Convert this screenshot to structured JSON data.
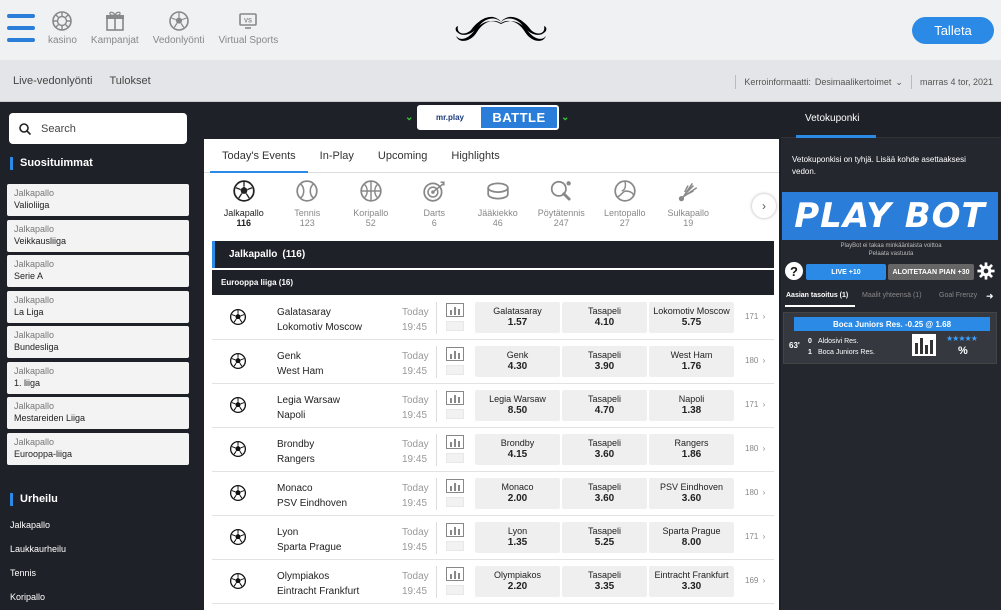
{
  "header": {
    "nav": [
      {
        "label": "kasino",
        "icon": "casino-chip-icon"
      },
      {
        "label": "Kampanjat",
        "icon": "gift-box-icon"
      },
      {
        "label": "Vedonlyönti",
        "icon": "soccer-ball-icon"
      },
      {
        "label": "Virtual Sports",
        "icon": "virtual-screen-icon"
      }
    ],
    "logo": "mustache-logo",
    "cta": "Talleta"
  },
  "subnav": {
    "links": [
      "Live-vedonlyönti",
      "Tulokset"
    ],
    "odds_label": "Kerroinformaatti:",
    "odds_value": "Desimaalikertoimet",
    "date": "marras 4 tor, 2021"
  },
  "sidebar": {
    "search_placeholder": "Search",
    "favorites_title": "Suosituimmat",
    "favorites": [
      {
        "sport": "Jalkapallo",
        "league": "Valioliiga"
      },
      {
        "sport": "Jalkapallo",
        "league": "Veikkausliiga"
      },
      {
        "sport": "Jalkapallo",
        "league": "Serie A"
      },
      {
        "sport": "Jalkapallo",
        "league": "La Liga"
      },
      {
        "sport": "Jalkapallo",
        "league": "Bundesliga"
      },
      {
        "sport": "Jalkapallo",
        "league": "1. liiga"
      },
      {
        "sport": "Jalkapallo",
        "league": "Mestareiden Liiga"
      },
      {
        "sport": "Jalkapallo",
        "league": "Eurooppa-liiga"
      }
    ],
    "sports_title": "Urheilu",
    "sports": [
      "Jalkapallo",
      "Laukkaurheilu",
      "Tennis",
      "Koripallo"
    ]
  },
  "banner": {
    "brand": "mr.play",
    "text": "BATTLE"
  },
  "main": {
    "tabs": [
      "Today's Events",
      "In-Play",
      "Upcoming",
      "Highlights"
    ],
    "active_tab": 0,
    "sports": [
      {
        "name": "Jalkapallo",
        "count": "116",
        "icon": "soccer-ball-icon"
      },
      {
        "name": "Tennis",
        "count": "123",
        "icon": "tennis-ball-icon"
      },
      {
        "name": "Koripallo",
        "count": "52",
        "icon": "basketball-icon"
      },
      {
        "name": "Darts",
        "count": "6",
        "icon": "darts-icon"
      },
      {
        "name": "Jääkiekko",
        "count": "46",
        "icon": "hockey-puck-icon"
      },
      {
        "name": "Pöytätennis",
        "count": "247",
        "icon": "table-tennis-icon"
      },
      {
        "name": "Lentopallo",
        "count": "27",
        "icon": "volleyball-icon"
      },
      {
        "name": "Sulkapallo",
        "count": "19",
        "icon": "shuttlecock-icon"
      }
    ],
    "sport_header": "Jalkapallo",
    "sport_header_count": "(116)",
    "league_header": "Eurooppa liiga (16)",
    "matches": [
      {
        "home": "Galatasaray",
        "away": "Lokomotiv Moscow",
        "day": "Today",
        "time": "19:45",
        "odds": [
          {
            "label": "Galatasaray",
            "value": "1.57"
          },
          {
            "label": "Tasapeli",
            "value": "4.10"
          },
          {
            "label": "Lokomotiv Moscow",
            "value": "5.75"
          }
        ],
        "more": "171"
      },
      {
        "home": "Genk",
        "away": "West Ham",
        "day": "Today",
        "time": "19:45",
        "odds": [
          {
            "label": "Genk",
            "value": "4.30"
          },
          {
            "label": "Tasapeli",
            "value": "3.90"
          },
          {
            "label": "West Ham",
            "value": "1.76"
          }
        ],
        "more": "180"
      },
      {
        "home": "Legia Warsaw",
        "away": "Napoli",
        "day": "Today",
        "time": "19:45",
        "odds": [
          {
            "label": "Legia Warsaw",
            "value": "8.50"
          },
          {
            "label": "Tasapeli",
            "value": "4.70"
          },
          {
            "label": "Napoli",
            "value": "1.38"
          }
        ],
        "more": "171"
      },
      {
        "home": "Brondby",
        "away": "Rangers",
        "day": "Today",
        "time": "19:45",
        "odds": [
          {
            "label": "Brondby",
            "value": "4.15"
          },
          {
            "label": "Tasapeli",
            "value": "3.60"
          },
          {
            "label": "Rangers",
            "value": "1.86"
          }
        ],
        "more": "180"
      },
      {
        "home": "Monaco",
        "away": "PSV Eindhoven",
        "day": "Today",
        "time": "19:45",
        "odds": [
          {
            "label": "Monaco",
            "value": "2.00"
          },
          {
            "label": "Tasapeli",
            "value": "3.60"
          },
          {
            "label": "PSV Eindhoven",
            "value": "3.60"
          }
        ],
        "more": "180"
      },
      {
        "home": "Lyon",
        "away": "Sparta Prague",
        "day": "Today",
        "time": "19:45",
        "odds": [
          {
            "label": "Lyon",
            "value": "1.35"
          },
          {
            "label": "Tasapeli",
            "value": "5.25"
          },
          {
            "label": "Sparta Prague",
            "value": "8.00"
          }
        ],
        "more": "171"
      },
      {
        "home": "Olympiakos",
        "away": "Eintracht Frankfurt",
        "day": "Today",
        "time": "19:45",
        "odds": [
          {
            "label": "Olympiakos",
            "value": "2.20"
          },
          {
            "label": "Tasapeli",
            "value": "3.35"
          },
          {
            "label": "Eintracht Frankfurt",
            "value": "3.30"
          }
        ],
        "more": "169"
      }
    ]
  },
  "betslip": {
    "title": "Vetokuponki",
    "empty_text": "Vetokuponkisi on tyhjä. Lisää kohde asettaaksesi vedon.",
    "playbot": {
      "banner": "PLAY BOT",
      "note1": "PlayBot ei takaa minkäänlaista voittoa",
      "note2": "Pelaata vastuuta",
      "help": "?",
      "live_btn": "LIVE +10",
      "soon_btn": "ALOITETAAN PIAN +30",
      "tabs": [
        "Aasian tasoitus (1)",
        "Maalit yhteensä (1)",
        "Goal Frenzy"
      ],
      "card": {
        "title": "Boca Juniors Res. -0.25 @ 1.68",
        "minute": "63'",
        "home_score": "0",
        "home_team": "Aldosivi Res.",
        "away_score": "1",
        "away_team": "Boca Juniors Res.",
        "stars": "★★★★★",
        "pct": "%"
      }
    }
  }
}
